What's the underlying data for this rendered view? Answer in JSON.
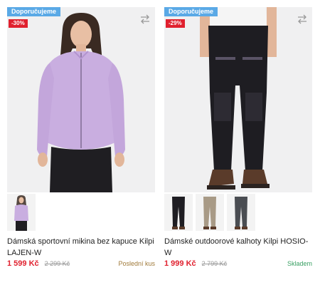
{
  "products": [
    {
      "badge_recommended": "Doporučujeme",
      "badge_discount": "-30%",
      "name": "Dámská sportovní mikina bez kapuce Kilpi LAJEN-W",
      "price": "1 599 Kč",
      "old_price": "2 299 Kč",
      "stock": "Poslední kus",
      "stock_color": "#a07a3a",
      "icon": "compare-arrows-icon"
    },
    {
      "badge_recommended": "Doporučujeme",
      "badge_discount": "-29%",
      "name": "Dámské outdoorové kalhoty Kilpi HOSIO-W",
      "price": "1 999 Kč",
      "old_price": "2 799 Kč",
      "stock": "Skladem",
      "stock_color": "#3aa064",
      "icon": "compare-arrows-icon"
    }
  ],
  "colors": {
    "accent_blue": "#5aa9e6",
    "discount_red": "#e0202e",
    "jacket_lavender": "#c9aee0",
    "pants_black": "#1e1d22"
  }
}
